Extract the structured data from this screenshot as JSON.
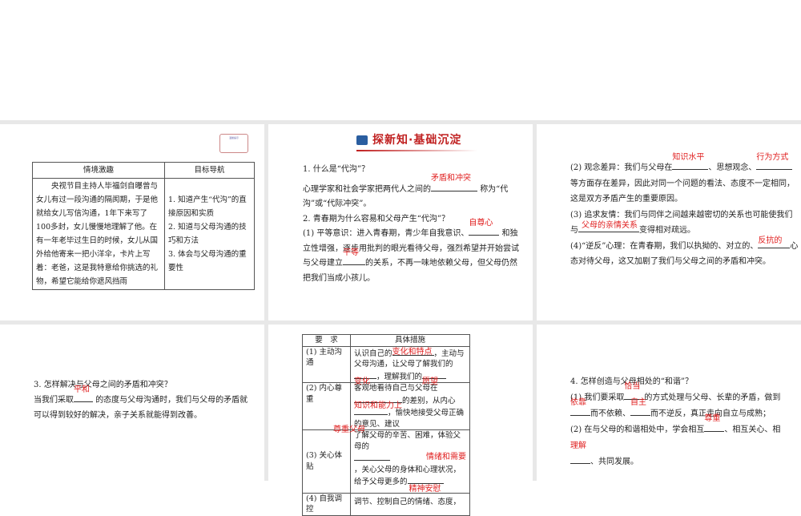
{
  "slide1": {
    "stamp": "温馨提示",
    "table": {
      "headers": [
        "情境激趣",
        "目标导航"
      ],
      "story": "央视节目主持人毕福剑自曝曾与女儿有过一段沟通的隔阂期，于是他就给女儿写信沟通，1年下来写了100多封，女儿慢慢地理解了他。在有一年老毕过生日的时候，女儿从国外给他寄来一把小洋伞，卡片上写着：老爸，这是我特意给你挑选的礼物，希望它能给你遮风挡雨",
      "goals": [
        "1. 知道产生“代沟”的直接原因和实质",
        "2. 知道与父母沟通的技巧和方法",
        "3. 体会与父母沟通的重要性"
      ]
    }
  },
  "slide2": {
    "banner": "探新知·基础沉淀",
    "q1": "1. 什么是“代沟”？",
    "q1a_pre": "心理学家和社会学家把两代人之间的",
    "q1a_ans": "矛盾和冲突",
    "q1a_post": "称为“代沟”或“代际冲突”。",
    "q2": "2. 青春期为什么容易和父母产生“代沟”？",
    "p1_pre": "(1) 平等意识：进入青春期，青少年自我意识、",
    "p1_ans1": "自尊心",
    "p1_mid": "和独立性增强，逐步用批判的眼光看待父母，强烈希望并开始尝试与父母建立",
    "p1_ans2": "平等",
    "p1_post": "的关系，不再一味地依赖父母，但父母仍然把我们当成小孩儿。"
  },
  "slide3": {
    "p2_pre": "(2) 观念差异：我们与父母在",
    "p2_ans1": "知识水平",
    "p2_mid": "、思想观念、",
    "p2_ans2": "行为方式",
    "p2_post": "等方面存在差异，因此对同一个问题的看法、态度不一定相同，这是双方矛盾产生的重要原因。",
    "p3_pre": "(3) 追求友情：我们与同伴之间越来越密切的关系也可能使我们与",
    "p3_ans": "父母的亲情关系",
    "p3_post": "变得相对疏远。",
    "p4_pre": "(4)“逆反”心理：在青春期，我们以执拗的、对立的、",
    "p4_ans": "反抗的",
    "p4_post": "心态对待父母，这又加剧了我们与父母之间的矛盾和冲突。"
  },
  "slide4": {
    "q3": "3. 怎样解决与父母之间的矛盾和冲突？",
    "a_pre": "当我们采取",
    "a_ans": "平和",
    "a_post": "的态度与父母沟通时，我们与父母的矛盾就可以得到较好的解决，亲子关系就能得到改善。"
  },
  "slide5": {
    "headers": [
      "要　求",
      "具体措施"
    ],
    "rows": [
      {
        "req": "(1) 主动沟通",
        "t1": "认识自己的",
        "a1": "变化和特点",
        "t2": "，主动与父母沟通，让父母了解我们的",
        "a2": "变化",
        "t3": "，理解我们的",
        "a3": "愿望"
      },
      {
        "req": "(2) 内心尊重",
        "t1": "客观地看待自己与父母在",
        "a1": "知识和能力上",
        "t2": "的差别，从内心",
        "a2": "尊重父母",
        "t3": "，愉快地接受父母正确的意见、建议"
      },
      {
        "req": "(3) 关心体贴",
        "t1": "了解父母的辛苦、困难，体验父母的",
        "a1": "情绪和需要",
        "t2": "，关心父母的身体和心理状况，给予父母更多的",
        "a2": "精神安慰",
        "t3": ""
      },
      {
        "req": "(4) 自我调控",
        "t1": "调节、控制自己的情绪、态度，",
        "a1": "",
        "t2": "",
        "a2": "",
        "t3": ""
      }
    ]
  },
  "slide6": {
    "q4": "4. 怎样创造与父母相处的“和谐”？",
    "p1_pre": "(1) 我们要采取",
    "p1_ans1": "恰当",
    "p1_mid1": "的方式处理与父母、长辈的矛盾，做到",
    "p1_ans2": "依靠",
    "p1_mid2": "而不依赖、",
    "p1_ans3": "自主",
    "p1_post": "而不逆反，真正走向自立与成熟；",
    "p2_pre": "(2) 在与父母的和谐相处中，学会相互",
    "p2_ans1": "尊重",
    "p2_mid": "、相互关心、相",
    "p2_ans2": "理解",
    "p2_post": "、共同发展。"
  }
}
